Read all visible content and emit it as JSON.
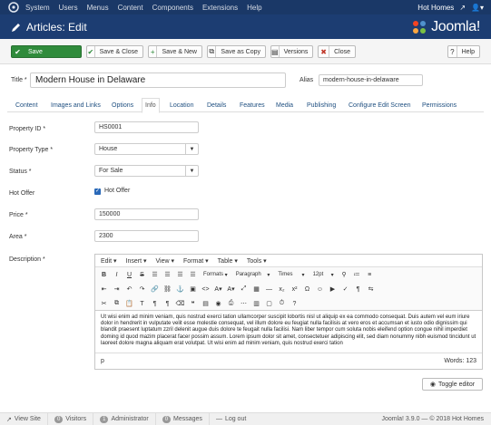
{
  "topnav": {
    "menu": [
      "System",
      "Users",
      "Menus",
      "Content",
      "Components",
      "Extensions",
      "Help"
    ],
    "site_name": "Hot Homes"
  },
  "titlebar": {
    "title": "Articles: Edit",
    "brand": "Joomla!"
  },
  "toolbar": {
    "save": "Save",
    "save_close": "Save & Close",
    "save_new": "Save & New",
    "save_copy": "Save as Copy",
    "versions": "Versions",
    "close": "Close",
    "help": "Help"
  },
  "form": {
    "title_label": "Title *",
    "title_value": "Modern House in Delaware",
    "alias_label": "Alias",
    "alias_value": "modern-house-in-delaware"
  },
  "tabs": [
    "Content",
    "Images and Links",
    "Options",
    "Info",
    "Location",
    "Details",
    "Features",
    "Media",
    "Publishing",
    "Configure Edit Screen",
    "Permissions"
  ],
  "active_tab": "Info",
  "fields": {
    "property_id": {
      "label": "Property ID *",
      "value": "HS0001"
    },
    "property_type": {
      "label": "Property Type *",
      "value": "House"
    },
    "status": {
      "label": "Status *",
      "value": "For Sale"
    },
    "hot_offer": {
      "label": "Hot Offer",
      "checkbox_label": "Hot Offer",
      "checked": true
    },
    "price": {
      "label": "Price *",
      "value": "150000"
    },
    "area": {
      "label": "Area *",
      "value": "2300"
    },
    "description": {
      "label": "Description *"
    }
  },
  "editor": {
    "menus": [
      "Edit",
      "Insert",
      "View",
      "Format",
      "Table",
      "Tools"
    ],
    "formats": "Formats",
    "paragraph": "Paragraph",
    "font": "Times",
    "size": "12pt",
    "content": "Ut wisi enim ad minim veniam, quis nostrud exerci tation ullamcorper suscipit lobortis nisl ut aliquip ex ea commodo consequat. Duis autem vel eum iriure dolor in hendrerit in vulputate velit esse molestie consequat, vel illum dolore eu feugiat nulla facilisis at vero eros et accumsan et iusto odio dignissim qui blandit praesent luptatum zzril delenit augue duis dolore te feugait nulla facilisi. Nam liber tempor cum soluta nobis eleifend option congue nihil imperdiet doming id quod mazim placerat facer possim assum. Lorem ipsum dolor sit amet, consectetuer adipiscing elit, sed diam nonummy nibh euismod tincidunt ut laoreet dolore magna aliquam erat volutpat. Ut wisi enim ad minim veniam, quis nostrud exerci tation",
    "path": "p",
    "word_count": "Words: 123"
  },
  "toggle_editor": "Toggle editor",
  "statusbar": {
    "view_site": "View Site",
    "visitors_count": "0",
    "visitors": "Visitors",
    "admin_count": "1",
    "administrator": "Administrator",
    "messages_count": "0",
    "messages": "Messages",
    "logout": "Log out",
    "version": "Joomla! 3.9.0 — © 2018 Hot Homes"
  },
  "colors": {
    "nav": "#1a3867",
    "titlebar": "#1c3d72",
    "save_green": "#2f8b3b",
    "link": "#205081",
    "close_red": "#c0392b"
  }
}
